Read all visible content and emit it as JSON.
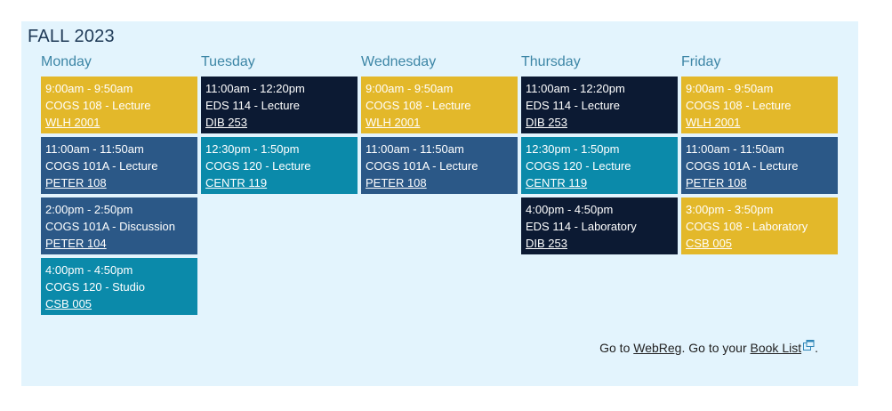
{
  "term": "FALL 2023",
  "colors": {
    "panel": "#e3f4fd",
    "gold": "#e3b82a",
    "navy": "#0c1a33",
    "blue": "#2b5887",
    "teal": "#0b8aaa",
    "day_header": "#3d86a6"
  },
  "days": [
    {
      "name": "Monday",
      "classes": [
        {
          "time": "9:00am - 9:50am",
          "course": "COGS 108 - Lecture",
          "location": "WLH 2001",
          "color": "gold"
        },
        {
          "time": "11:00am - 11:50am",
          "course": "COGS 101A - Lecture",
          "location": "PETER 108",
          "color": "blue"
        },
        {
          "time": "2:00pm - 2:50pm",
          "course": "COGS 101A - Discussion",
          "location": "PETER 104",
          "color": "blue"
        },
        {
          "time": "4:00pm - 4:50pm",
          "course": "COGS 120 - Studio",
          "location": "CSB 005",
          "color": "teal"
        }
      ]
    },
    {
      "name": "Tuesday",
      "classes": [
        {
          "time": "11:00am - 12:20pm",
          "course": "EDS 114 - Lecture",
          "location": "DIB 253",
          "color": "navy"
        },
        {
          "time": "12:30pm - 1:50pm",
          "course": "COGS 120 - Lecture",
          "location": "CENTR 119",
          "color": "teal"
        }
      ]
    },
    {
      "name": "Wednesday",
      "classes": [
        {
          "time": "9:00am - 9:50am",
          "course": "COGS 108 - Lecture",
          "location": "WLH 2001",
          "color": "gold"
        },
        {
          "time": "11:00am - 11:50am",
          "course": "COGS 101A - Lecture",
          "location": "PETER 108",
          "color": "blue"
        }
      ]
    },
    {
      "name": "Thursday",
      "classes": [
        {
          "time": "11:00am - 12:20pm",
          "course": "EDS 114 - Lecture",
          "location": "DIB 253",
          "color": "navy"
        },
        {
          "time": "12:30pm - 1:50pm",
          "course": "COGS 120 - Lecture",
          "location": "CENTR 119",
          "color": "teal"
        },
        {
          "time": "4:00pm - 4:50pm",
          "course": "EDS 114 - Laboratory",
          "location": "DIB 253",
          "color": "navy"
        }
      ]
    },
    {
      "name": "Friday",
      "classes": [
        {
          "time": "9:00am - 9:50am",
          "course": "COGS 108 - Lecture",
          "location": "WLH 2001",
          "color": "gold"
        },
        {
          "time": "11:00am - 11:50am",
          "course": "COGS 101A - Lecture",
          "location": "PETER 108",
          "color": "blue"
        },
        {
          "time": "3:00pm - 3:50pm",
          "course": "COGS 108 - Laboratory",
          "location": "CSB 005",
          "color": "gold"
        }
      ]
    }
  ],
  "footer": {
    "text_goto": "Go to ",
    "webreg_link": "WebReg",
    "text_mid": ". Go to your ",
    "booklist_link": "Book List",
    "text_end": ".",
    "external_icon": "external-link-icon"
  }
}
